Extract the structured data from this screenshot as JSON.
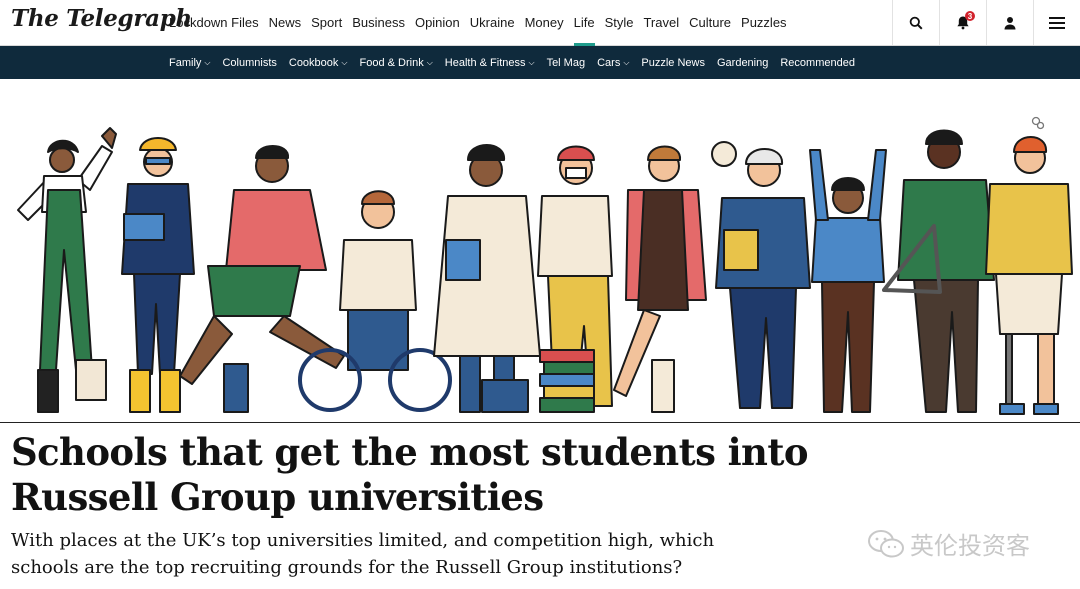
{
  "header": {
    "logo": "The Telegraph",
    "nav": [
      {
        "label": "Lockdown Files"
      },
      {
        "label": "News"
      },
      {
        "label": "Sport"
      },
      {
        "label": "Business"
      },
      {
        "label": "Opinion"
      },
      {
        "label": "Ukraine"
      },
      {
        "label": "Money"
      },
      {
        "label": "Life",
        "active": true
      },
      {
        "label": "Style"
      },
      {
        "label": "Travel"
      },
      {
        "label": "Culture"
      },
      {
        "label": "Puzzles"
      }
    ],
    "tools": {
      "search_icon": "search-icon",
      "notifications_icon": "bell-icon",
      "notifications_count": "3",
      "account_icon": "user-icon",
      "menu_icon": "hamburger-icon"
    },
    "accent_color": "#1f9c8c"
  },
  "subnav": {
    "items": [
      {
        "label": "Family",
        "dropdown": true
      },
      {
        "label": "Columnists",
        "dropdown": false
      },
      {
        "label": "Cookbook",
        "dropdown": true
      },
      {
        "label": "Food & Drink",
        "dropdown": true
      },
      {
        "label": "Health & Fitness",
        "dropdown": true
      },
      {
        "label": "Tel Mag",
        "dropdown": false
      },
      {
        "label": "Cars",
        "dropdown": true
      },
      {
        "label": "Puzzle News",
        "dropdown": false
      },
      {
        "label": "Gardening",
        "dropdown": false
      },
      {
        "label": "Recommended",
        "dropdown": false
      }
    ],
    "background": "#0f2a3c"
  },
  "hero": {
    "illustration": "group-of-students-and-professionals-illustration"
  },
  "article": {
    "headline": "Schools that get the most students into Russell Group universities",
    "standfirst": "With places at the UK’s top universities limited, and competition high, which schools are the top recruiting grounds for the Russell Group institutions?"
  },
  "watermark": {
    "text": "英伦投资客",
    "icon": "wechat-icon"
  }
}
